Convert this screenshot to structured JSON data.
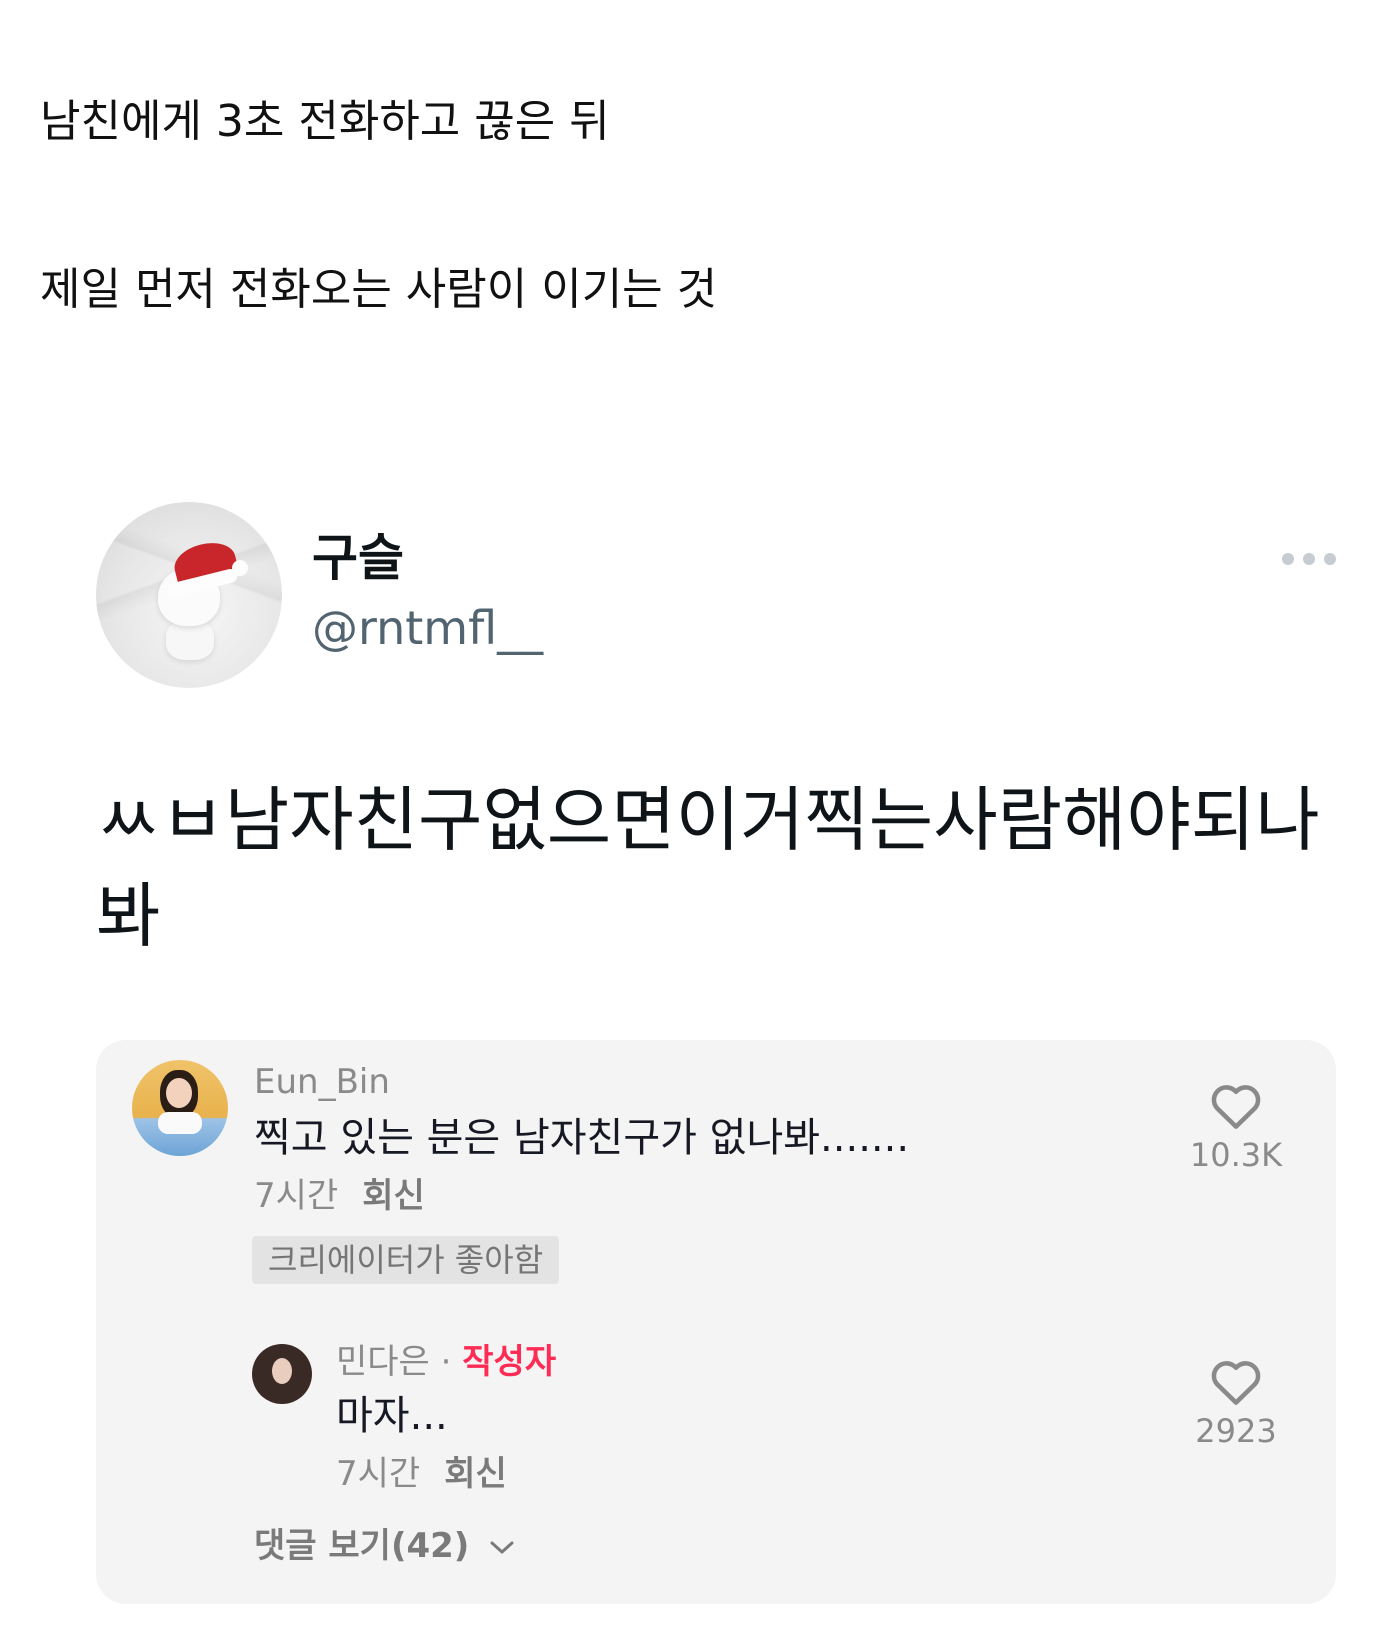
{
  "intro": {
    "line1": "남친에게 3초 전화하고 끊은 뒤",
    "line2": "제일 먼저 전화오는 사람이 이기는 것"
  },
  "tweet": {
    "display_name": "구슬",
    "handle": "@rntmfl__",
    "text": "ㅆㅂ남자친구없으면이거찍는사람해야되나봐",
    "more_icon": "more-horizontal-icon"
  },
  "comments": {
    "first": {
      "username": "Eun_Bin",
      "text": "찍고 있는 분은 남자친구가 없나봐.......",
      "time": "7시간",
      "reply_label": "회신",
      "badge": "크리에이터가 좋아함",
      "likes": "10.3K",
      "like_icon": "heart-icon"
    },
    "second": {
      "username": "민다은",
      "separator": " · ",
      "author_tag": "작성자",
      "text": "마자...",
      "time": "7시간",
      "reply_label": "회신",
      "likes": "2923",
      "like_icon": "heart-icon"
    },
    "view_replies": "댓글 보기(42)",
    "colors": {
      "panel_background": "#f4f4f4",
      "author_tag": "#fe2c55",
      "muted_text": "#8a8a8a"
    }
  }
}
